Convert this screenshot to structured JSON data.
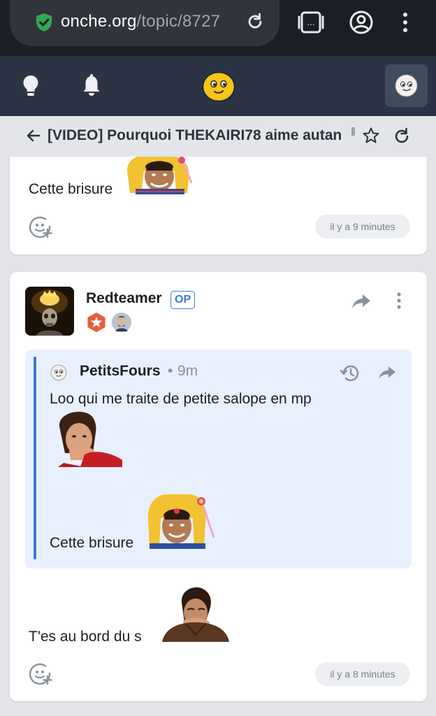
{
  "browser": {
    "url_host": "onche.org",
    "url_path": "/topic/8727",
    "icons": [
      "shield-check-icon",
      "reload-icon",
      "tab-switcher-icon",
      "account-icon",
      "menu-icon"
    ],
    "accent": "#34a853"
  },
  "app": {
    "header_icons": [
      "lightbulb-icon",
      "bell-icon",
      "onche-logo",
      "user-avatar"
    ],
    "header_bg": "#2c3344"
  },
  "topic": {
    "title": "[VIDEO] Pourquoi THEKAIRI78 aime autan"
  },
  "posts": [
    {
      "text": "Cette brisure",
      "time": "il y a 9 minutes"
    },
    {
      "author": "Redteamer",
      "op_badge": "OP",
      "quote": {
        "author": "PetitsFours",
        "separator": "•",
        "time": "9m",
        "line1": "Loo qui me traite de petite salope en mp",
        "line2": "Cette brisure"
      },
      "text": "T'es au bord du s",
      "time": "il y a 8 minutes"
    }
  ],
  "colors": {
    "accent_blue": "#3a7bd5",
    "quote_bg": "#e9f0fd",
    "page_bg": "#e3e5e9"
  }
}
